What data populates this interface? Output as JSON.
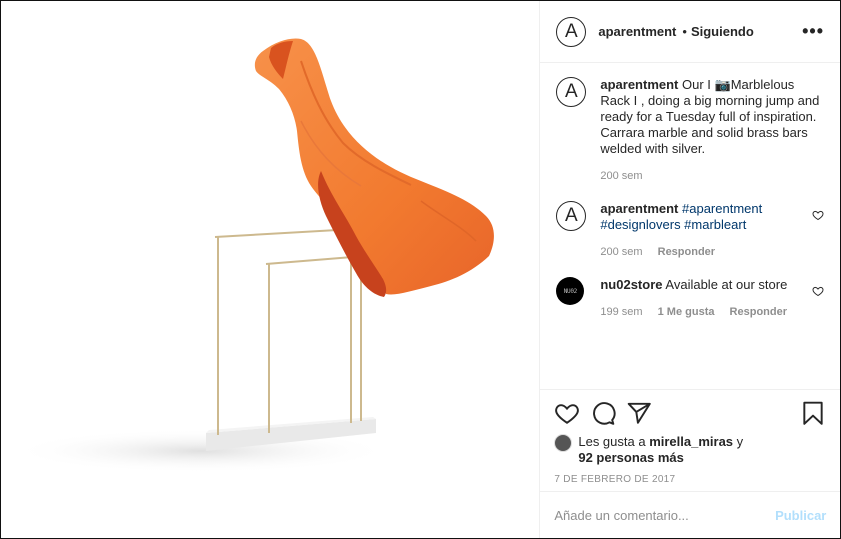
{
  "post": {
    "author": "aparentment",
    "follow_status": "Siguiendo",
    "dot": "•",
    "more_glyph": "•••",
    "avatar_letter": "A"
  },
  "caption": {
    "username": "aparentment",
    "text": "Our I 📷Marblelous Rack I , doing a big morning jump and ready for a Tuesday full of inspiration. Carrara marble and solid brass bars welded with silver.",
    "time": "200 sem"
  },
  "comments": [
    {
      "username": "aparentment",
      "hashtags": "#aparentment #designlovers #marbleart",
      "time": "200 sem",
      "reply": "Responder"
    },
    {
      "username": "nu02store",
      "avatar_text": "NU02",
      "text": "Available at our store",
      "time": "199 sem",
      "likes": "1 Me gusta",
      "reply": "Responder"
    }
  ],
  "likes": {
    "prefix": "Les gusta a",
    "user": "mirella_miras",
    "and": "y",
    "others": "92 personas más"
  },
  "date": "7 DE FEBRERO DE 2017",
  "add_comment": {
    "placeholder": "Añade un comentario...",
    "post_label": "Publicar"
  },
  "colors": {
    "scarf_light": "#f5873d",
    "scarf_dark": "#c9441c",
    "brass": "#c9b48a",
    "marble": "#e6e6e6",
    "link": "#00376b",
    "publish": "#b2dffc"
  }
}
